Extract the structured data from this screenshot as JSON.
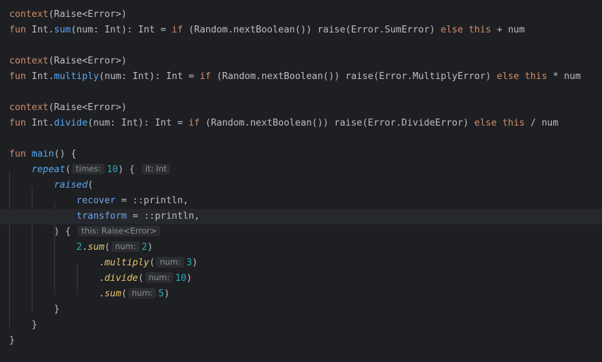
{
  "editor": {
    "language": "Kotlin",
    "hints": {
      "times": "times:",
      "it_int": "it: Int",
      "this_raise": "this: Raise<Error>",
      "num": "num:"
    },
    "colors": {
      "background": "#1e1f22",
      "keyword": "#cf8e6d",
      "function": "#56a8f5",
      "number": "#2aacb8",
      "text": "#bcbec4"
    }
  }
}
